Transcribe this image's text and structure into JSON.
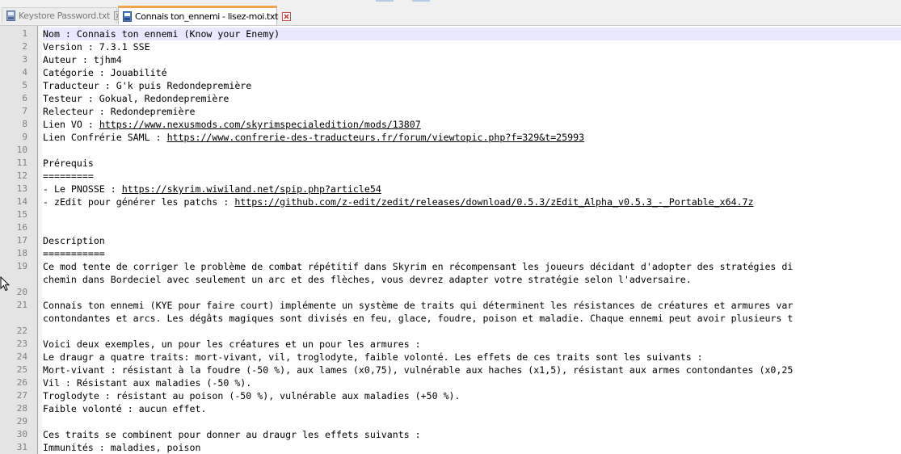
{
  "tabs": [
    {
      "label": "Keystore Password.txt",
      "active": false
    },
    {
      "label": "Connais ton_ennemi - lisez-moi.txt",
      "active": true
    }
  ],
  "editor": {
    "lines": [
      {
        "num": "1",
        "text": "Nom : Connais ton ennemi (Know your Enemy)"
      },
      {
        "num": "2",
        "text": "Version : 7.3.1 SSE"
      },
      {
        "num": "3",
        "text": "Auteur : tjhm4"
      },
      {
        "num": "4",
        "text": "Catégorie : Jouabilité"
      },
      {
        "num": "5",
        "text": "Traducteur : G'k puis Redondepremière"
      },
      {
        "num": "6",
        "text": "Testeur : Gokual, Redondepremière"
      },
      {
        "num": "7",
        "text": "Relecteur : Redondepremière"
      },
      {
        "num": "8",
        "text": "Lien VO : ",
        "link": "https://www.nexusmods.com/skyrimspecialedition/mods/13807"
      },
      {
        "num": "9",
        "text": "Lien Confrérie SAML : ",
        "link": "https://www.confrerie-des-traducteurs.fr/forum/viewtopic.php?f=329&t=25993"
      },
      {
        "num": "10",
        "text": ""
      },
      {
        "num": "11",
        "text": "Prérequis"
      },
      {
        "num": "12",
        "text": "========="
      },
      {
        "num": "13",
        "text": "- Le PNOSSE : ",
        "link": "https://skyrim.wiwiland.net/spip.php?article54"
      },
      {
        "num": "14",
        "text": "- zEdit pour générer les patchs : ",
        "link": "https://github.com/z-edit/zedit/releases/download/0.5.3/zEdit_Alpha_v0.5.3_-_Portable_x64.7z"
      },
      {
        "num": "15",
        "text": ""
      },
      {
        "num": "16",
        "text": ""
      },
      {
        "num": "17",
        "text": "Description"
      },
      {
        "num": "18",
        "text": "==========="
      },
      {
        "num": "19",
        "text": "Ce mod tente de corriger le problème de combat répétitif dans Skyrim en récompensant les joueurs décidant d'adopter des stratégies di"
      },
      {
        "num": "",
        "text": "chemin dans Bordeciel avec seulement un arc et des flèches, vous devrez adapter votre stratégie selon l'adversaire."
      },
      {
        "num": "20",
        "text": ""
      },
      {
        "num": "21",
        "text": "Connais ton ennemi (KYE pour faire court) implémente un système de traits qui déterminent les résistances de créatures et armures var"
      },
      {
        "num": "",
        "text": "contondantes et arcs. Les dégâts magiques sont divisés en feu, glace, foudre, poison et maladie. Chaque ennemi peut avoir plusieurs t"
      },
      {
        "num": "22",
        "text": ""
      },
      {
        "num": "23",
        "text": "Voici deux exemples, un pour les créatures et un pour les armures :"
      },
      {
        "num": "24",
        "text": "Le draugr a quatre traits: mort-vivant, vil, troglodyte, faible volonté. Les effets de ces traits sont les suivants :"
      },
      {
        "num": "25",
        "text": "Mort-vivant : résistant à la foudre (-50 %), aux lames (x0,75), vulnérable aux haches (x1,5), résistant aux armes contondantes (x0,25"
      },
      {
        "num": "26",
        "text": "Vil : Résistant aux maladies (-50 %)."
      },
      {
        "num": "27",
        "text": "Troglodyte : résistant au poison (-50 %), vulnérable aux maladies (+50 %)."
      },
      {
        "num": "28",
        "text": "Faible volonté : aucun effet."
      },
      {
        "num": "29",
        "text": ""
      },
      {
        "num": "30",
        "text": "Ces traits se combinent pour donner au draugr les effets suivants :"
      },
      {
        "num": "31",
        "text": "Immunités : maladies, poison"
      }
    ]
  }
}
